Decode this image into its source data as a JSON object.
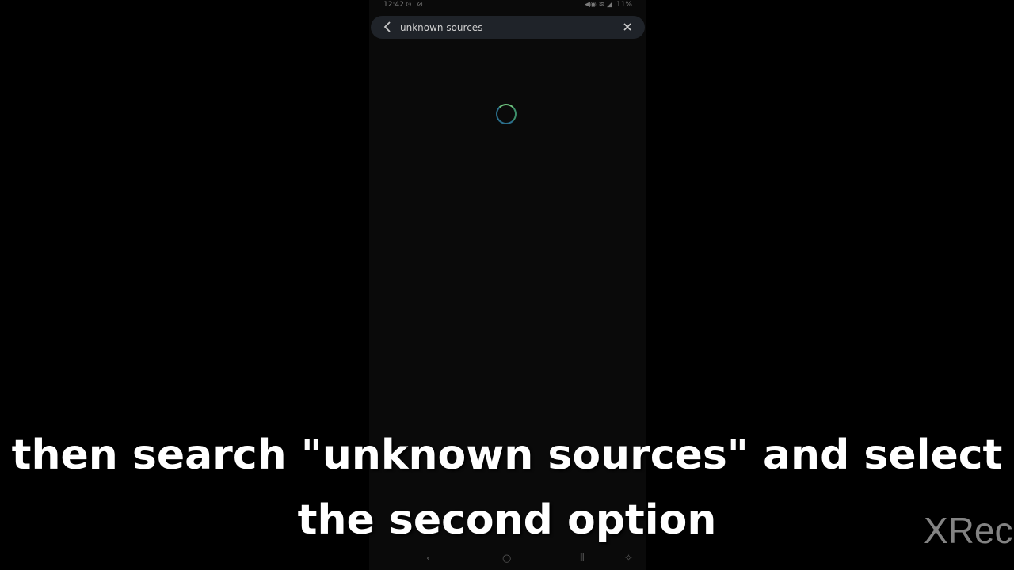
{
  "status_bar": {
    "time": "12:42",
    "left_icons": "⊙ ⊘",
    "right_icons": "◀◉ ≋ ◢",
    "battery": "11%"
  },
  "search": {
    "value": "unknown sources",
    "back_icon": "chevron-left-icon",
    "clear_icon": "close-icon"
  },
  "loading": {
    "spinner_colors": [
      "#6cc07d",
      "#2b6f8c"
    ]
  },
  "nav_bar": {
    "back_glyph": "‹",
    "home_glyph": "○",
    "recents_glyph": "⦀",
    "accessibility_glyph": "✧"
  },
  "caption": {
    "line1": "then search \"unknown sources\" and select",
    "line2": "the second option"
  },
  "watermark": {
    "text": "XRec"
  }
}
